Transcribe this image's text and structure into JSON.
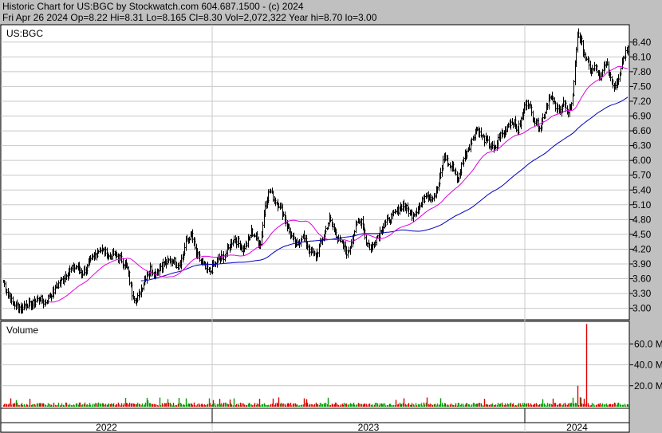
{
  "header": {
    "line1": "Historic Chart for US:BGC by Stockwatch.com 604.687.1500 - (c) 2024",
    "line2": "Fri Apr 26 2024   Op=8.22   Hi=8.31   Lo=8.165   Cl=8.30   Vol=2,072,322   Year hi=8.70   lo=3.00"
  },
  "colors": {
    "background": "#c0c0c0",
    "panel": "#ffffff",
    "grid": "#c8c8c8",
    "price_bars": "#000000",
    "ma_short": "#e000e0",
    "ma_long": "#0000c0",
    "volume_up": "#00a000",
    "volume_down": "#e00000"
  },
  "chart_data": [
    {
      "type": "ohlc",
      "title": "US:BGC",
      "x_axis": {
        "labels": [
          "2022",
          "2023",
          "2024"
        ]
      },
      "y_axis": {
        "ticks": [
          "8.40",
          "8.10",
          "7.80",
          "7.50",
          "7.20",
          "6.90",
          "6.60",
          "6.30",
          "6.00",
          "5.70",
          "5.40",
          "5.10",
          "4.80",
          "4.50",
          "4.20",
          "3.90",
          "3.60",
          "3.30",
          "3.00"
        ],
        "range": [
          2.8,
          8.72
        ]
      },
      "grid": true,
      "series": [
        {
          "kind": "price",
          "weekly_close": [
            3.55,
            3.3,
            3.1,
            3.05,
            3.0,
            3.1,
            3.05,
            3.15,
            3.2,
            3.1,
            3.25,
            3.35,
            3.5,
            3.6,
            3.75,
            3.8,
            3.85,
            3.7,
            3.8,
            3.95,
            4.1,
            4.2,
            4.15,
            4.05,
            4.1,
            4.05,
            3.95,
            3.8,
            3.3,
            3.15,
            3.4,
            3.65,
            3.8,
            3.7,
            3.85,
            3.9,
            3.95,
            4.0,
            3.85,
            4.05,
            4.4,
            4.5,
            4.1,
            3.95,
            3.8,
            3.75,
            3.9,
            4.0,
            4.05,
            4.2,
            4.4,
            4.35,
            4.2,
            4.3,
            4.55,
            4.45,
            4.3,
            5.1,
            5.4,
            5.2,
            5.1,
            4.9,
            4.6,
            4.4,
            4.25,
            4.5,
            4.3,
            4.15,
            4.05,
            4.3,
            4.55,
            4.8,
            4.6,
            4.4,
            4.25,
            4.1,
            4.45,
            4.7,
            4.8,
            4.35,
            4.2,
            4.4,
            4.55,
            4.7,
            4.8,
            4.9,
            5.0,
            5.1,
            5.0,
            4.9,
            5.0,
            5.1,
            5.35,
            5.25,
            5.3,
            5.6,
            6.1,
            5.9,
            5.85,
            5.6,
            6.0,
            6.2,
            6.4,
            6.65,
            6.5,
            6.4,
            6.3,
            6.2,
            6.5,
            6.55,
            6.75,
            6.8,
            6.6,
            6.9,
            7.25,
            6.95,
            6.75,
            6.7,
            7.0,
            7.35,
            7.1,
            7.0,
            7.2,
            6.9,
            7.3,
            8.6,
            8.35,
            8.0,
            7.8,
            7.9,
            7.6,
            8.0,
            7.75,
            7.5,
            7.7,
            8.1,
            8.3
          ]
        },
        {
          "kind": "moving_average",
          "name": "short MA",
          "color": "#e000e0"
        },
        {
          "kind": "moving_average",
          "name": "long MA",
          "color": "#0000c0",
          "starts_at_week": 30
        }
      ]
    },
    {
      "type": "bar",
      "title": "Volume",
      "y_axis": {
        "ticks": [
          "60.0 M",
          "40.0 M",
          "20.0 M"
        ],
        "range": [
          0,
          80
        ]
      },
      "spike_values_millions": [
        {
          "week": 127,
          "value": 79
        },
        {
          "week": 125,
          "value": 20
        }
      ]
    }
  ]
}
